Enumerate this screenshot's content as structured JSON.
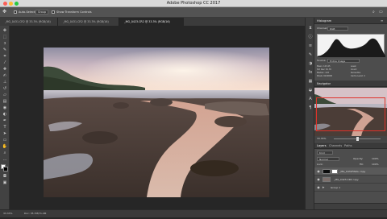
{
  "window": {
    "title": "Adobe Photoshop CC 2017"
  },
  "options_bar": {
    "auto_select_label": "Auto-Select:",
    "auto_select_value": "Group",
    "transform_label": "Show Transform Controls"
  },
  "tabs": [
    {
      "label": "_MG_0431.CR2 @ 33.3% (RGB/16)"
    },
    {
      "label": "_MG_0431.CR2 @ 33.3% (RGB/16)"
    },
    {
      "label": "_MG_0423.CR2 @ 33.3% (RGB/16)"
    }
  ],
  "histogram": {
    "title": "Histogram",
    "channel_label": "Channel:",
    "channel_value": "RGB",
    "source_label": "Source:",
    "source_value": "Entire Image",
    "stats": {
      "mean_label": "Mean:",
      "mean": "123.45",
      "stddev_label": "Std Dev:",
      "stddev": "52.78",
      "median_label": "Median:",
      "median": "118",
      "pixels_label": "Pixels:",
      "pixels": "6240000",
      "level_label": "Level:",
      "count_label": "Count:",
      "percentile_label": "Percentile:",
      "cache_label": "Cache Level:",
      "cache": "4"
    }
  },
  "navigator": {
    "title": "Navigator",
    "zoom": "33.33%"
  },
  "layers_panel": {
    "tabs": [
      "Layers",
      "Channels",
      "Paths"
    ],
    "kind_label": "Kind",
    "blend_mode": "Normal",
    "opacity_label": "Opacity:",
    "opacity": "100%",
    "fill_label": "Fill:",
    "fill": "100%",
    "lock_label": "Lock:",
    "layers": [
      {
        "name": "_MG_0431FINAL copy"
      },
      {
        "name": "_MG_0423.CR2 copy"
      },
      {
        "name": "Group 1"
      }
    ]
  },
  "status": {
    "zoom": "33.33%",
    "doc_info": "Doc: 35.7M/71.4M"
  },
  "colors": {
    "accent": "#2d6fb5",
    "panel": "#4d4d4d",
    "background": "#262626"
  }
}
